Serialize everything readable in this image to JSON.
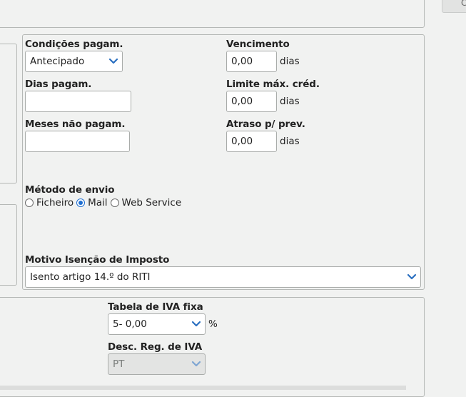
{
  "top_button": {
    "label": "C"
  },
  "payment": {
    "payment_conditions": {
      "label": "Condições pagam.",
      "value": "Antecipado"
    },
    "payment_days": {
      "label": "Dias pagam.",
      "value": ""
    },
    "non_payment_months": {
      "label": "Meses não pagam.",
      "value": ""
    },
    "due": {
      "label": "Vencimento",
      "value": "0,00",
      "unit": "dias"
    },
    "credit_limit": {
      "label": "Limite máx. créd.",
      "value": "0,00",
      "unit": "dias"
    },
    "delay": {
      "label": "Atraso p/ prev.",
      "value": "0,00",
      "unit": "dias"
    }
  },
  "shipping": {
    "label": "Método de envio",
    "options": [
      {
        "label": "Ficheiro",
        "checked": false
      },
      {
        "label": "Mail",
        "checked": true
      },
      {
        "label": "Web Service",
        "checked": false
      }
    ]
  },
  "tax_exemption": {
    "label": "Motivo Isenção de Imposto",
    "value": "Isento artigo 14.º do RITI"
  },
  "vat": {
    "fixed_table": {
      "label": "Tabela de IVA fixa",
      "value": "5- 0,00",
      "unit": "%"
    },
    "region": {
      "label": "Desc. Reg. de IVA",
      "value": "PT"
    }
  },
  "colors": {
    "accent": "#1f6fd1",
    "chevron": "#2a6fc0",
    "border": "#b5b8b6",
    "background": "#f1f2f1"
  }
}
